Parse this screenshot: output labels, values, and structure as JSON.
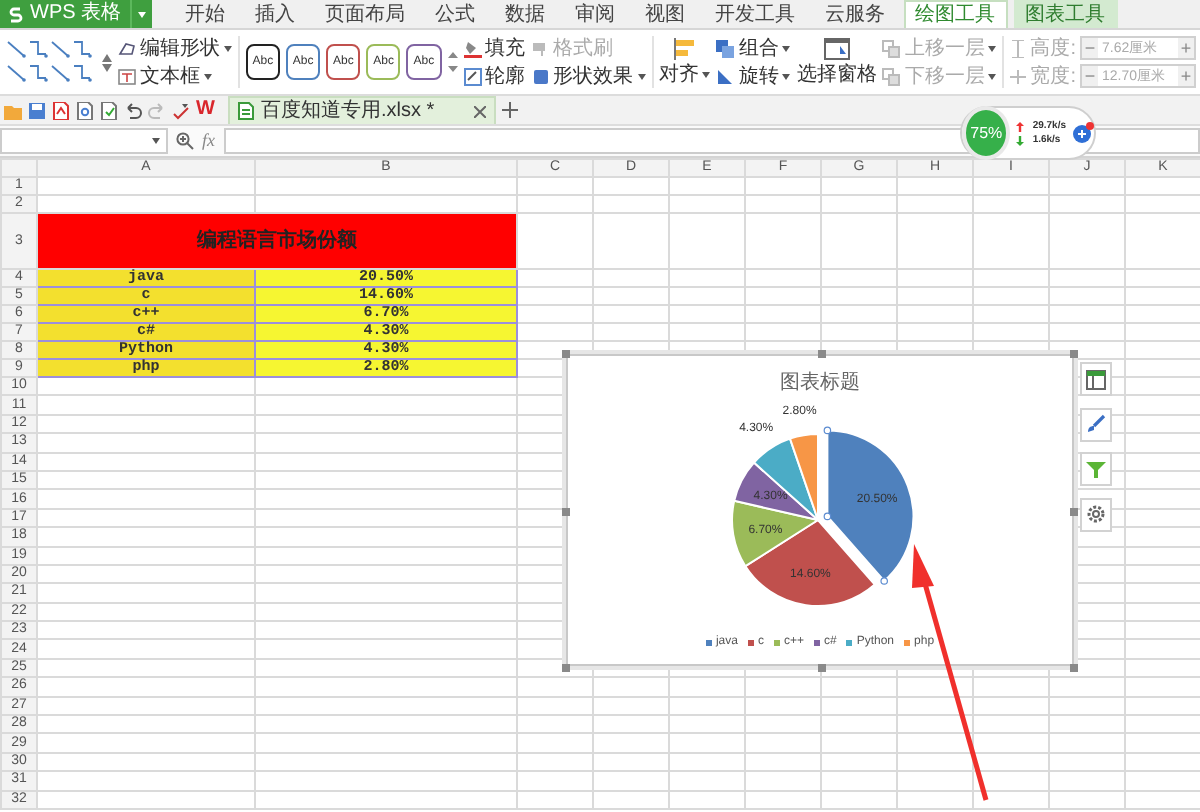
{
  "app_button": {
    "label": "WPS 表格"
  },
  "menu_tabs": [
    {
      "label": "开始",
      "selected": false,
      "contextual": false
    },
    {
      "label": "插入",
      "selected": false,
      "contextual": false
    },
    {
      "label": "页面布局",
      "selected": false,
      "contextual": false
    },
    {
      "label": "公式",
      "selected": false,
      "contextual": false
    },
    {
      "label": "数据",
      "selected": false,
      "contextual": false
    },
    {
      "label": "审阅",
      "selected": false,
      "contextual": false
    },
    {
      "label": "视图",
      "selected": false,
      "contextual": false
    },
    {
      "label": "开发工具",
      "selected": false,
      "contextual": false
    },
    {
      "label": "云服务",
      "selected": false,
      "contextual": false
    },
    {
      "label": "绘图工具",
      "selected": true,
      "contextual": true
    },
    {
      "label": "图表工具",
      "selected": false,
      "contextual": true
    }
  ],
  "ribbon": {
    "edit_shape": "编辑形状",
    "text_box": "文本框",
    "style_samples": [
      {
        "label": "Abc",
        "color": "#222222"
      },
      {
        "label": "Abc",
        "color": "#4f81bd"
      },
      {
        "label": "Abc",
        "color": "#c0504d"
      },
      {
        "label": "Abc",
        "color": "#9bbb59"
      },
      {
        "label": "Abc",
        "color": "#8064a2"
      }
    ],
    "fill": "填充",
    "outline": "轮廓",
    "format_painter": {
      "label": "格式刷",
      "disabled": true
    },
    "shape_effects": "形状效果",
    "align": "对齐",
    "group": "组合",
    "rotate": "旋转",
    "selection_pane": "选择窗格",
    "bring_forward": {
      "label": "上移一层",
      "disabled": true
    },
    "send_backward": {
      "label": "下移一层",
      "disabled": true
    },
    "size_fields": [
      {
        "label": "高度:",
        "value": "7.62厘米",
        "decrement": "−",
        "increment": "+",
        "disabled": true
      },
      {
        "label": "宽度:",
        "value": "12.70厘米",
        "decrement": "−",
        "increment": "+",
        "disabled": true
      }
    ]
  },
  "quick_bar": {
    "logo": "W"
  },
  "document_tabs": [
    {
      "title": "百度知道专用.xlsx *",
      "selected": true
    }
  ],
  "formula_bar": {
    "function_label": "fx"
  },
  "speed_widget": {
    "percent": "75%",
    "upload": "29.7k/s",
    "download": "1.6k/s"
  },
  "sheet": {
    "columns": [
      "A",
      "B",
      "C",
      "D",
      "E",
      "F",
      "G",
      "H",
      "I",
      "J",
      "K"
    ],
    "row_numbers": [
      "1",
      "2",
      "3",
      "4",
      "5",
      "6",
      "7",
      "8",
      "9",
      "10",
      "11",
      "12",
      "13",
      "14",
      "15",
      "16",
      "17",
      "18",
      "19",
      "20",
      "21",
      "22",
      "23",
      "24",
      "25",
      "26",
      "27",
      "28",
      "29",
      "30",
      "31",
      "32"
    ],
    "title": "编程语言市场份额",
    "rows": [
      {
        "language": "java",
        "share": "20.50%"
      },
      {
        "language": "c",
        "share": "14.60%"
      },
      {
        "language": "c++",
        "share": "6.70%"
      },
      {
        "language": "c#",
        "share": "4.30%"
      },
      {
        "language": "Python",
        "share": "4.30%"
      },
      {
        "language": "php",
        "share": "2.80%"
      }
    ]
  },
  "chart": {
    "chart_data": {
      "type": "pie",
      "title": "图表标题",
      "categories": [
        "java",
        "c",
        "c++",
        "c#",
        "Python",
        "php"
      ],
      "values": [
        20.5,
        14.6,
        6.7,
        4.3,
        4.3,
        2.8
      ],
      "value_labels": [
        "20.50%",
        "14.60%",
        "6.70%",
        "4.30%",
        "4.30%",
        "2.80%"
      ],
      "legend": "bottom"
    },
    "slices": [
      {
        "color": "#4f81bd",
        "selected": true,
        "kind": "inside"
      },
      {
        "color": "#c0504d",
        "selected": false,
        "kind": "inside"
      },
      {
        "color": "#9bbb59",
        "selected": false,
        "kind": "inside"
      },
      {
        "color": "#8064a2",
        "selected": false,
        "kind": "inside"
      },
      {
        "color": "#4bacc6",
        "selected": false,
        "kind": "outside"
      },
      {
        "color": "#f79646",
        "selected": false,
        "kind": "outside"
      }
    ]
  }
}
